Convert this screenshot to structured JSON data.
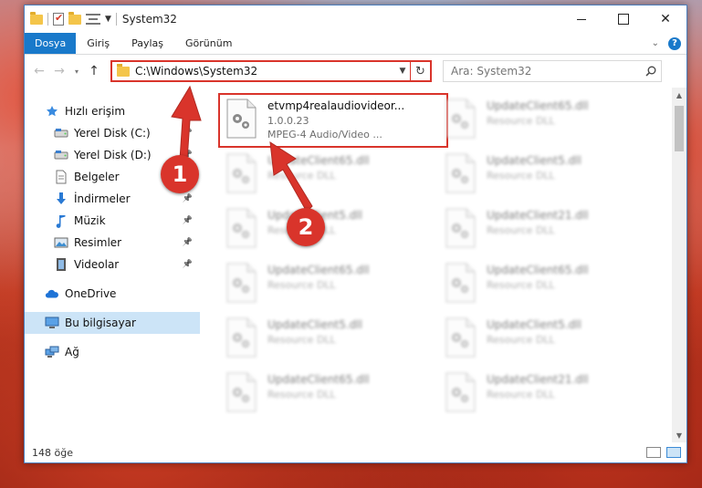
{
  "window": {
    "title": "System32",
    "ribbon_tabs": [
      "Dosya",
      "Giriş",
      "Paylaş",
      "Görünüm"
    ],
    "help_label": "?"
  },
  "address": {
    "path": "C:\\Windows\\System32",
    "search_placeholder": "Ara: System32"
  },
  "sidebar": {
    "items": [
      {
        "label": "Hızlı erişim",
        "icon": "star-icon",
        "level": 0
      },
      {
        "label": "Yerel Disk (C:)",
        "icon": "drive-icon",
        "level": 1,
        "pinned": true
      },
      {
        "label": "Yerel Disk (D:)",
        "icon": "drive-icon",
        "level": 1,
        "pinned": true
      },
      {
        "label": "Belgeler",
        "icon": "document-icon",
        "level": 1,
        "pinned": true
      },
      {
        "label": "İndirmeler",
        "icon": "download-icon",
        "level": 1,
        "pinned": true
      },
      {
        "label": "Müzik",
        "icon": "music-icon",
        "level": 1,
        "pinned": true
      },
      {
        "label": "Resimler",
        "icon": "picture-icon",
        "level": 1,
        "pinned": true
      },
      {
        "label": "Videolar",
        "icon": "video-icon",
        "level": 1,
        "pinned": true
      },
      {
        "label": "OneDrive",
        "icon": "cloud-icon",
        "level": 0
      },
      {
        "label": "Bu bilgisayar",
        "icon": "computer-icon",
        "level": 0,
        "selected": true
      },
      {
        "label": "Ağ",
        "icon": "network-icon",
        "level": 0
      }
    ]
  },
  "files": [
    {
      "name": "etvmp4realaudiovideor...",
      "line1": "1.0.0.23",
      "line2": "MPEG-4 Audio/Video ...",
      "highlight": true
    },
    {
      "name": "UpdateClient65.dll",
      "line1": "Resource DLL"
    },
    {
      "name": "UpdateClient65.dll",
      "line1": "Resource DLL"
    },
    {
      "name": "UpdateClient5.dll",
      "line1": "Resource DLL"
    },
    {
      "name": "UpdateClient5.dll",
      "line1": "Resource DLL"
    },
    {
      "name": "UpdateClient21.dll",
      "line1": "Resource DLL"
    },
    {
      "name": "UpdateClient65.dll",
      "line1": "Resource DLL"
    },
    {
      "name": "UpdateClient65.dll",
      "line1": "Resource DLL"
    },
    {
      "name": "UpdateClient5.dll",
      "line1": "Resource DLL"
    },
    {
      "name": "UpdateClient5.dll",
      "line1": "Resource DLL"
    },
    {
      "name": "UpdateClient65.dll",
      "line1": "Resource DLL"
    },
    {
      "name": "UpdateClient21.dll",
      "line1": "Resource DLL"
    }
  ],
  "status": {
    "item_count": "148 öğe"
  },
  "annotations": {
    "step1": "1",
    "step2": "2",
    "accent": "#d9342b"
  }
}
